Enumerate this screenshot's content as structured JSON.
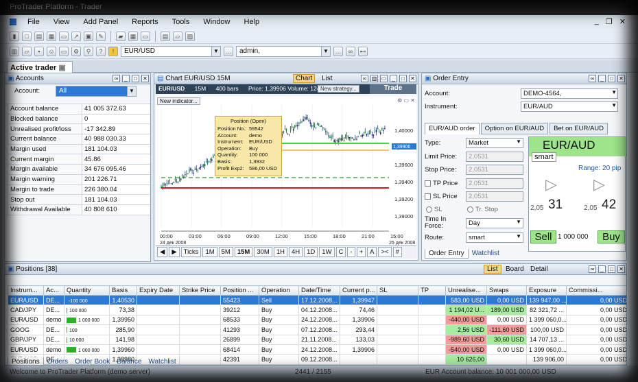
{
  "window": {
    "title": "ProTrader Platform - Trader"
  },
  "menu": [
    "File",
    "View",
    "Add Panel",
    "Reports",
    "Tools",
    "Window",
    "Help"
  ],
  "toolbar2": {
    "symbol": "EUR/USD",
    "account": "admin,"
  },
  "active_tab": "Active trader",
  "accounts": {
    "title": "Accounts",
    "account_label": "Account:",
    "account_value": "All",
    "rows": [
      {
        "k": "Account balance",
        "v": "41 005 372.63"
      },
      {
        "k": "Blocked balance",
        "v": "0"
      },
      {
        "k": "Unrealised profit/loss",
        "v": "-17 342.89"
      },
      {
        "k": "Current balance",
        "v": "40 988 030.33"
      },
      {
        "k": "Margin used",
        "v": "181 104.03"
      },
      {
        "k": "Current margin",
        "v": "45.86"
      },
      {
        "k": "Margin available",
        "v": "34 676 095.46"
      },
      {
        "k": "Margin warning",
        "v": "201 226.71"
      },
      {
        "k": "Margin to trade",
        "v": "226 380.04"
      },
      {
        "k": "Stop out",
        "v": "181 104.03"
      },
      {
        "k": "Withdrawal Available",
        "v": "40 808 610"
      }
    ]
  },
  "chart": {
    "title": "Chart EUR/USD 15M",
    "tab_chart": "Chart",
    "tab_list": "List",
    "symbol": "EUR/USD",
    "period": "15M",
    "bars": "400 bars",
    "price_info": "Price: 1,39906 Volume: 124",
    "new_strategy": "New strategy...",
    "trade": "Trade",
    "new_indicator": "New indicator...",
    "price_labels": [
      "1,40000",
      "1,39800",
      "1,39600",
      "1,39400",
      "1,39200",
      "1,39000"
    ],
    "current_price": "1,39906",
    "time_labels": [
      "00:00",
      "03:00",
      "06:00",
      "09:00",
      "12:00",
      "15:00",
      "18:00",
      "21:00",
      "15:00"
    ],
    "date_left": "24 дек 2008",
    "date_right": "25 дек 2008",
    "periods": [
      "Ticks",
      "1M",
      "5M",
      "15M",
      "30M",
      "1H",
      "4H",
      "1D",
      "1W",
      "C"
    ],
    "selected_period": "15M",
    "tooltip": {
      "title": "Position (Open)",
      "rows": [
        {
          "k": "Position No.:",
          "v": "59542"
        },
        {
          "k": "Account:",
          "v": "demo"
        },
        {
          "k": "Instrument:",
          "v": "EUR/USD"
        },
        {
          "k": "Operation:",
          "v": "Buy"
        },
        {
          "k": "Quantity:",
          "v": "100 000"
        },
        {
          "k": "Basis:",
          "v": "1,3932"
        },
        {
          "k": "Profit Exp2:",
          "v": "586,00 USD"
        }
      ]
    }
  },
  "order_entry": {
    "title": "Order Entry",
    "account_label": "Account:",
    "account_value": "DEMO-4564,",
    "instrument_label": "Instrument:",
    "instrument_value": "EUR/AUD",
    "tabs": [
      "EUR/AUD order",
      "Option on EUR/AUD",
      "Bet on EUR/AUD"
    ],
    "type_label": "Type:",
    "type_value": "Market",
    "limit_label": "Limit Price:",
    "limit_value": "2,0531",
    "stop_label": "Stop Price:",
    "stop_value": "2,0531",
    "tp_label": "TP Price",
    "tp_value": "2,0531",
    "sl_label": "SL Price",
    "sl_value": "2,0531",
    "sl_radio": "SL",
    "trstop_radio": "Tr. Stop",
    "tif_label": "Time In Force:",
    "tif_value": "Day",
    "route_label": "Route:",
    "route_value": "smart",
    "quote_symbol": "EUR/AUD",
    "quote_route": "smart",
    "range": "Range: 20 pip",
    "sell_big": "31",
    "sell_small": "2,05",
    "buy_big": "42",
    "buy_small": "2,05",
    "sell_label": "Sell",
    "buy_label": "Buy",
    "amount": "1 000 000",
    "bottom_tabs": [
      "Order Entry",
      "Watchlist"
    ]
  },
  "positions": {
    "title": "Positions",
    "count": "[38]",
    "view_tabs": [
      "List",
      "Board",
      "Detail"
    ],
    "columns": [
      "Instrum...",
      "Ac...",
      "Quantity",
      "Basis",
      "Expiry Date",
      "Strike Price",
      "Position ...",
      "Operation",
      "Date/Time",
      "Current p...",
      "SL",
      "TP",
      "Unrealise...",
      "Swaps",
      "Exposure",
      "Commissi..."
    ],
    "rows": [
      {
        "instr": "EUR/USD",
        "acc": "DE...",
        "qty": "-100 000",
        "qbar": 0,
        "basis": "1,40530",
        "pos": "55423",
        "op": "Sell",
        "dt": "17.12.2008...",
        "cur": "1,39947",
        "unr": "583,00 USD",
        "unr_sign": "pos",
        "swaps": "0,00 USD",
        "swaps_sign": "",
        "exp": "139 947,00 ...",
        "comm": "0,00 USD"
      },
      {
        "instr": "CAD/JPY",
        "acc": "DE...",
        "qty": "100 000",
        "qbar": 1,
        "basis": "73,38",
        "pos": "39212",
        "op": "Buy",
        "dt": "04.12.2008...",
        "cur": "74,46",
        "unr": "1 194,02 U...",
        "unr_sign": "pos",
        "swaps": "189,00 USD",
        "swaps_sign": "pos",
        "exp": "82 321,72 ...",
        "comm": "0,00 USD"
      },
      {
        "instr": "EUR/USD",
        "acc": "demo",
        "qty": "1 000 000",
        "qbar": 14,
        "basis": "1,39950",
        "pos": "68533",
        "op": "Buy",
        "dt": "24.12.2008...",
        "cur": "1,39906",
        "unr": "-440,00 USD",
        "unr_sign": "neg",
        "swaps": "0,00 USD",
        "swaps_sign": "",
        "exp": "1 399 060,0...",
        "comm": "0,00 USD"
      },
      {
        "instr": "GOOG",
        "acc": "DE...",
        "qty": "100",
        "qbar": 1,
        "basis": "285,90",
        "pos": "41293",
        "op": "Buy",
        "dt": "07.12.2008...",
        "cur": "293,44",
        "unr": "2,56 USD",
        "unr_sign": "pos",
        "swaps": "-111,60 USD",
        "swaps_sign": "neg",
        "exp": "100,00 USD",
        "comm": "0,00 USD"
      },
      {
        "instr": "GBP/JPY",
        "acc": "DE...",
        "qty": "10 000",
        "qbar": 1,
        "basis": "141,98",
        "pos": "26899",
        "op": "Buy",
        "dt": "21.11.2008...",
        "cur": "133,03",
        "unr": "-989,60 USD",
        "unr_sign": "neg",
        "swaps": "30,60 USD",
        "swaps_sign": "pos",
        "exp": "14 707,13 ...",
        "comm": "0,00 USD"
      },
      {
        "instr": "EUR/USD",
        "acc": "demo",
        "qty": "1 000 000",
        "qbar": 14,
        "basis": "1,39960",
        "pos": "68414",
        "op": "Buy",
        "dt": "24.12.2008...",
        "cur": "1,39906",
        "unr": "-540,00 USD",
        "unr_sign": "neg",
        "swaps": "0,00 USD",
        "swaps_sign": "",
        "exp": "1 399 060,0...",
        "comm": "0,00 USD"
      },
      {
        "instr": "EUR/USD",
        "acc": "DE...",
        "qty": "",
        "qbar": 0,
        "basis": "1,38980",
        "pos": "42391",
        "op": "Buy",
        "dt": "09.12.2008...",
        "cur": "",
        "unr": "10 626,00",
        "unr_sign": "pos",
        "swaps": "",
        "swaps_sign": "",
        "exp": "139 906,00",
        "comm": "0,00 USD"
      }
    ],
    "bottom_tabs": [
      "Positions",
      "Orders",
      "Order Book",
      "Balance",
      "Watchlist"
    ]
  },
  "status": {
    "text": "Welcome to ProTrader Platform (demo server)",
    "mid": "2441 / 2155",
    "right": "EUR  Account balance: 10 001 000,00 USD"
  }
}
